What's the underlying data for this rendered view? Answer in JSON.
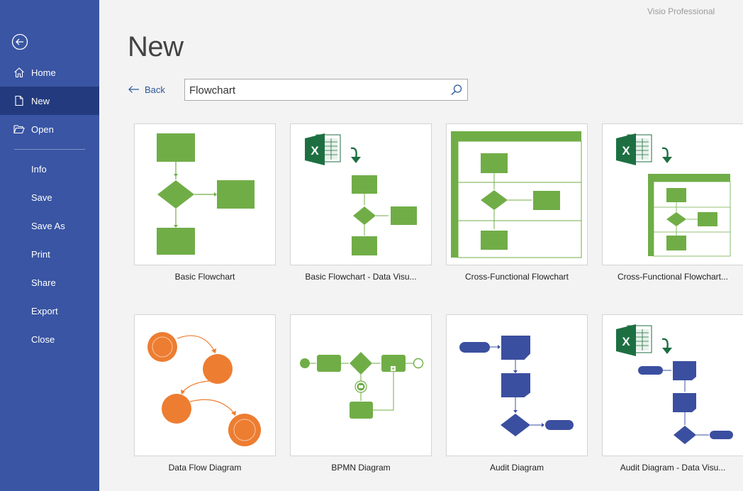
{
  "app": {
    "name": "Visio Professional"
  },
  "sidebar": {
    "items": [
      {
        "label": "Home"
      },
      {
        "label": "New"
      },
      {
        "label": "Open"
      },
      {
        "label": "Info"
      },
      {
        "label": "Save"
      },
      {
        "label": "Save As"
      },
      {
        "label": "Print"
      },
      {
        "label": "Share"
      },
      {
        "label": "Export"
      },
      {
        "label": "Close"
      }
    ]
  },
  "page": {
    "title": "New",
    "back_label": "Back"
  },
  "search": {
    "value": "Flowchart"
  },
  "templates": [
    {
      "name": "Basic Flowchart"
    },
    {
      "name": "Basic Flowchart - Data Visu..."
    },
    {
      "name": "Cross-Functional Flowchart"
    },
    {
      "name": "Cross-Functional Flowchart..."
    },
    {
      "name": "Data Flow Diagram"
    },
    {
      "name": "BPMN Diagram"
    },
    {
      "name": "Audit Diagram"
    },
    {
      "name": "Audit Diagram - Data Visu..."
    }
  ],
  "colors": {
    "sidebar": "#3955a3",
    "sidebar_active": "#233b7e",
    "green": "#70ad47",
    "orange": "#ed7d31",
    "blue": "#3b4fa0",
    "excel": "#1d6f42"
  }
}
